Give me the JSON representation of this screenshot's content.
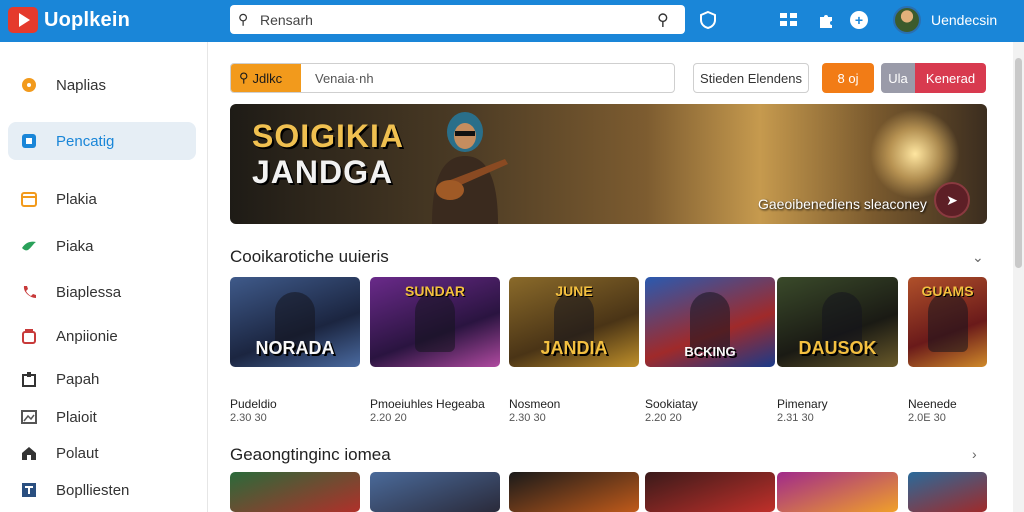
{
  "header": {
    "app_name": "Uoplkein",
    "search_placeholder": "Rensarh",
    "username": "Uendecsin",
    "icons": [
      "search-icon",
      "shield-icon",
      "grid-icon",
      "puzzle-icon",
      "plus-icon",
      "avatar"
    ]
  },
  "sidebar": {
    "items": [
      {
        "label": "Naplias",
        "icon": "circle-icon",
        "color": "#f29a1c"
      },
      {
        "label": "Pencatig",
        "icon": "square-icon",
        "color": "#1a86d8"
      },
      {
        "label": "Plakia",
        "icon": "calendar-icon",
        "color": "#f29a1c"
      },
      {
        "label": "Piaka",
        "icon": "bird-icon",
        "color": "#2aa15a"
      },
      {
        "label": "Biaplessa",
        "icon": "phone-icon",
        "color": "#c83a3a"
      },
      {
        "label": "Anpiionie",
        "icon": "bag-icon",
        "color": "#c83a3a"
      },
      {
        "label": "Papah",
        "icon": "box-icon",
        "color": "#333333"
      },
      {
        "label": "Plaioit",
        "icon": "image-icon",
        "color": "#555555"
      },
      {
        "label": "Polaut",
        "icon": "home-icon",
        "color": "#333333"
      },
      {
        "label": "Boplliesten",
        "icon": "t-icon",
        "color": "#2a4f80"
      }
    ],
    "active_index": 1
  },
  "toolbar": {
    "filter_tag": "Jdlkc",
    "filter_input": "Venaia·nh",
    "outline_button": "Stieden Elendens",
    "orange_button": "8 oj",
    "gray_button": "Ula",
    "red_button": "Kenerad"
  },
  "banner": {
    "title_line1": "SOIGIKIA",
    "title_line2": "JANDGA",
    "caption": "Gaeoibenediens sleaconey"
  },
  "sections": [
    {
      "title": "Cooikarotiche uuieris",
      "cards": [
        {
          "art_top": "",
          "art_text": "NORADA",
          "name": "Pudeldio",
          "meta": "2.30 30"
        },
        {
          "art_top": "SUNDAR",
          "art_text": "",
          "name": "Pmoeiuhles Hegeaba",
          "meta": "2.20 20"
        },
        {
          "art_top": "JUNE",
          "art_text": "JANDIA",
          "name": "Nosmeon",
          "meta": "2.30 30"
        },
        {
          "art_top": "",
          "art_text": "BCKING",
          "name": "Sookiatay",
          "meta": "2.20 20"
        },
        {
          "art_top": "",
          "art_text": "DAUSOK",
          "name": "Pimenary",
          "meta": "2.31 30"
        },
        {
          "art_top": "GUAMS",
          "art_text": "",
          "name": "Neenede",
          "meta": "2.0E 30"
        }
      ]
    },
    {
      "title": "Geaongtinginc iomea",
      "cards": [
        {
          "art_top": "",
          "art_text": "",
          "name": "",
          "meta": ""
        },
        {
          "art_top": "",
          "art_text": "",
          "name": "",
          "meta": ""
        },
        {
          "art_top": "",
          "art_text": "",
          "name": "",
          "meta": ""
        },
        {
          "art_top": "",
          "art_text": "",
          "name": "",
          "meta": ""
        },
        {
          "art_top": "",
          "art_text": "",
          "name": "",
          "meta": ""
        },
        {
          "art_top": "",
          "art_text": "",
          "name": "",
          "meta": ""
        }
      ]
    }
  ],
  "colors": {
    "header": "#1a86d8",
    "accent_orange": "#f27c16",
    "accent_red": "#d83a4f"
  }
}
